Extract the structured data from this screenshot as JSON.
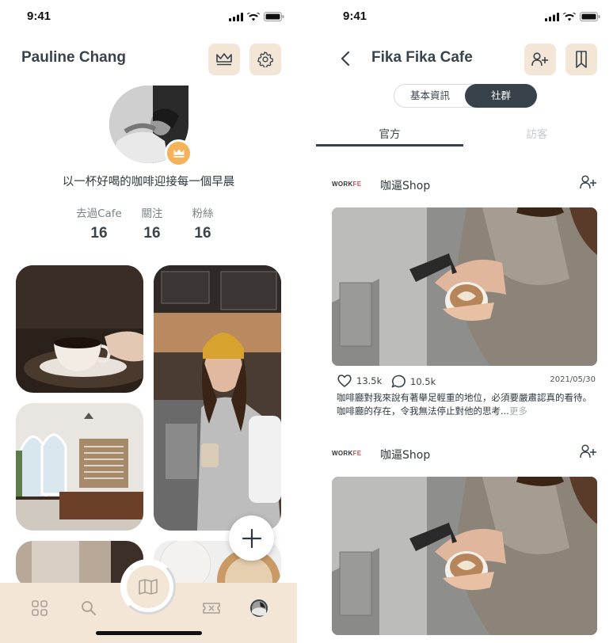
{
  "left": {
    "status": {
      "time": "9:41"
    },
    "profile_name": "Pauline Chang",
    "bio": "以一杯好喝的咖啡迎接每一個早晨",
    "stats": [
      {
        "label": "去過Cafe",
        "value": "16"
      },
      {
        "label": "關注",
        "value": "16"
      },
      {
        "label": "粉絲",
        "value": "16"
      }
    ],
    "header_icons": [
      "crown-icon",
      "gear-icon"
    ],
    "tab_icons": [
      "grid-icon",
      "search-icon",
      "map-icon",
      "ticket-icon",
      "avatar-icon"
    ]
  },
  "right": {
    "status": {
      "time": "9:41"
    },
    "title": "Fika Fika Cafe",
    "segment": {
      "option_a": "基本資訊",
      "option_b": "社群",
      "selected": "社群"
    },
    "subtabs": {
      "official": "官方",
      "visitor": "訪客",
      "selected": "官方"
    },
    "posts": [
      {
        "logo_a": "WORK",
        "logo_b": "FE",
        "shop": "咖逼Shop",
        "likes": "13.5k",
        "comments": "10.5k",
        "date": "2021/05/30",
        "text": "咖啡廳對我來說有著舉足輕重的地位，必須要嚴肅認真的看待。咖啡廳的存在，令我無法停止對他的思考...",
        "more": "更多"
      },
      {
        "logo_a": "WORK",
        "logo_b": "FE",
        "shop": "咖逼Shop"
      }
    ]
  },
  "colors": {
    "accent_beige": "#f3e6d6",
    "badge_orange": "#f5b259",
    "dark": "#37424a"
  }
}
